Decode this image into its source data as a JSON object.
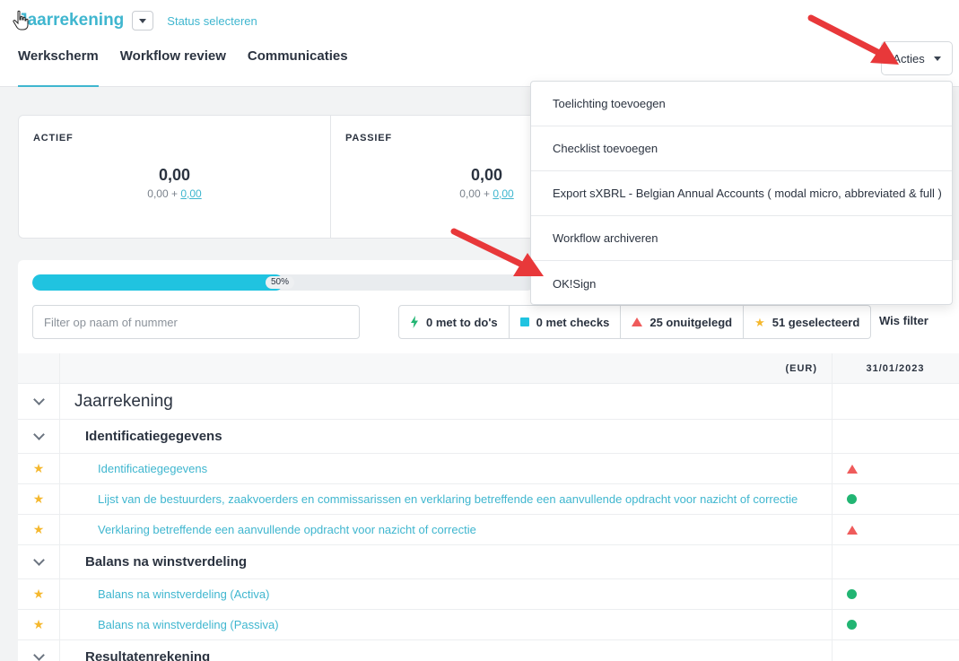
{
  "header": {
    "title": "Jaarrekening",
    "status_link": "Status selecteren",
    "tabs": [
      {
        "label": "Werkscherm",
        "active": true
      },
      {
        "label": "Workflow review",
        "active": false
      },
      {
        "label": "Communicaties",
        "active": false
      }
    ],
    "acties_label": "Acties"
  },
  "summary": {
    "actief": {
      "label": "ACTIEF",
      "value": "0,00",
      "sub_left": "0,00 +",
      "sub_link": "0,00"
    },
    "passief": {
      "label": "PASSIEF",
      "value": "0,00",
      "sub_left": "0,00 +",
      "sub_link": "0,00"
    }
  },
  "progress": {
    "value": 0.5,
    "label": "50%"
  },
  "filter": {
    "placeholder": "Filter op naam of nummer"
  },
  "chips": [
    {
      "icon": "bolt-icon",
      "label": "0 met to do's"
    },
    {
      "icon": "square-icon",
      "label": "0 met checks"
    },
    {
      "icon": "triangle-icon",
      "label": "25 onuitgelegd"
    },
    {
      "icon": "star-icon",
      "label": "51 geselecteerd"
    }
  ],
  "wis_filter": "Wis filter",
  "table": {
    "currency_header": "(EUR)",
    "date_header": "31/01/2023",
    "rows": [
      {
        "kind": "h1",
        "label": "Jaarrekening",
        "status": ""
      },
      {
        "kind": "h2",
        "label": "Identificatiegegevens",
        "status": ""
      },
      {
        "kind": "item",
        "label": "Identificatiegegevens",
        "status": "warning"
      },
      {
        "kind": "item",
        "label": "Lijst van de bestuurders, zaakvoerders en commissarissen en verklaring betreffende een aanvullende opdracht voor nazicht of correctie",
        "status": "ok"
      },
      {
        "kind": "item",
        "label": "Verklaring betreffende een aanvullende opdracht voor nazicht of correctie",
        "status": "warning"
      },
      {
        "kind": "h2",
        "label": "Balans na winstverdeling",
        "status": ""
      },
      {
        "kind": "item",
        "label": "Balans na winstverdeling (Activa)",
        "status": "ok"
      },
      {
        "kind": "item",
        "label": "Balans na winstverdeling (Passiva)",
        "status": "ok"
      },
      {
        "kind": "h2",
        "label": "Resultatenrekening",
        "status": ""
      }
    ]
  },
  "dropdown": {
    "items": [
      "Toelichting toevoegen",
      "Checklist toevoegen",
      "Export sXBRL - Belgian Annual Accounts ( modal micro, abbreviated & full )",
      "Workflow archiveren",
      "OK!Sign"
    ]
  },
  "colors": {
    "accent": "#3fb6cf",
    "progress": "#20c3e0",
    "warning": "#ef5b5b",
    "ok": "#22b573",
    "star": "#f5b82e",
    "arrow": "#e8383a"
  }
}
